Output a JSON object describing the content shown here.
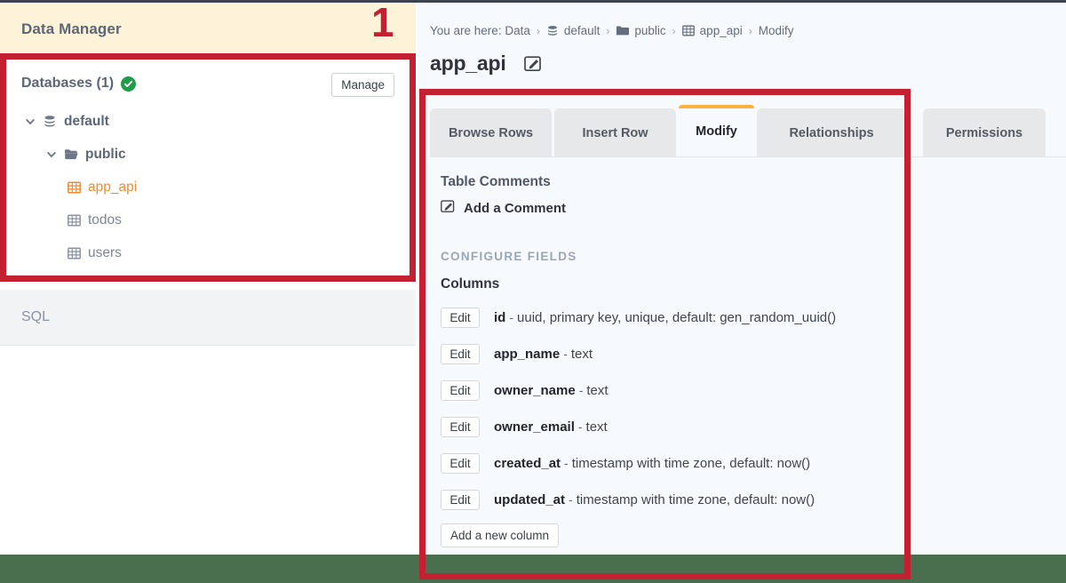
{
  "sidebar": {
    "header_title": "Data Manager",
    "databases_label": "Databases (1)",
    "status_icon": "check-circle-icon",
    "manage_label": "Manage",
    "tree": [
      {
        "label": "default",
        "icon": "database-stack-icon",
        "level": 1,
        "expanded": true,
        "chevron": "chevron-down-icon",
        "active": false
      },
      {
        "label": "public",
        "icon": "folder-open-icon",
        "level": 2,
        "expanded": true,
        "chevron": "chevron-down-icon",
        "active": false
      },
      {
        "label": "app_api",
        "icon": "table-grid-icon",
        "level": 3,
        "expanded": false,
        "chevron": "",
        "active": true
      },
      {
        "label": "todos",
        "icon": "table-grid-icon",
        "level": 3,
        "expanded": false,
        "chevron": "",
        "active": false
      },
      {
        "label": "users",
        "icon": "table-grid-icon",
        "level": 3,
        "expanded": false,
        "chevron": "",
        "active": false
      }
    ],
    "sql_label": "SQL"
  },
  "main": {
    "breadcrumb": {
      "prefix": "You are here: Data",
      "items": [
        {
          "label": "default",
          "icon": "database-stack-icon"
        },
        {
          "label": "public",
          "icon": "folder-filled-icon"
        },
        {
          "label": "app_api",
          "icon": "table-grid-icon"
        },
        {
          "label": "Modify",
          "icon": ""
        }
      ],
      "separator": "›"
    },
    "page_title": "app_api",
    "edit_title_icon": "pencil-square-icon",
    "tabs": [
      {
        "label": "Browse Rows",
        "active": false
      },
      {
        "label": "Insert Row",
        "active": false
      },
      {
        "label": "Modify",
        "active": true
      },
      {
        "label": "Relationships",
        "active": false
      },
      {
        "label": "Permissions",
        "active": false
      }
    ],
    "table_comments_title": "Table Comments",
    "add_comment_label": "Add a Comment",
    "add_comment_icon": "pencil-square-icon",
    "configure_fields_label": "CONFIGURE FIELDS",
    "columns_title": "Columns",
    "edit_button_label": "Edit",
    "dash": "-",
    "columns": [
      {
        "name": "id",
        "type": "uuid, primary key, unique, default: gen_random_uuid()"
      },
      {
        "name": "app_name",
        "type": "text"
      },
      {
        "name": "owner_name",
        "type": "text"
      },
      {
        "name": "owner_email",
        "type": "text"
      },
      {
        "name": "created_at",
        "type": "timestamp with time zone, default: now()"
      },
      {
        "name": "updated_at",
        "type": "timestamp with time zone, default: now()"
      }
    ],
    "add_column_label": "Add a new column"
  },
  "annotations": {
    "step_number": "1",
    "highlight_color": "#c32032"
  },
  "colors": {
    "header_cream": "#fdf3d8",
    "annotation_red": "#c32032",
    "active_tab_accent": "#fbb040",
    "active_table_orange": "#f08a30",
    "status_green": "#1e9e4a",
    "bottom_bar_green": "#4a6f4e",
    "content_bg": "#f7fafc"
  }
}
